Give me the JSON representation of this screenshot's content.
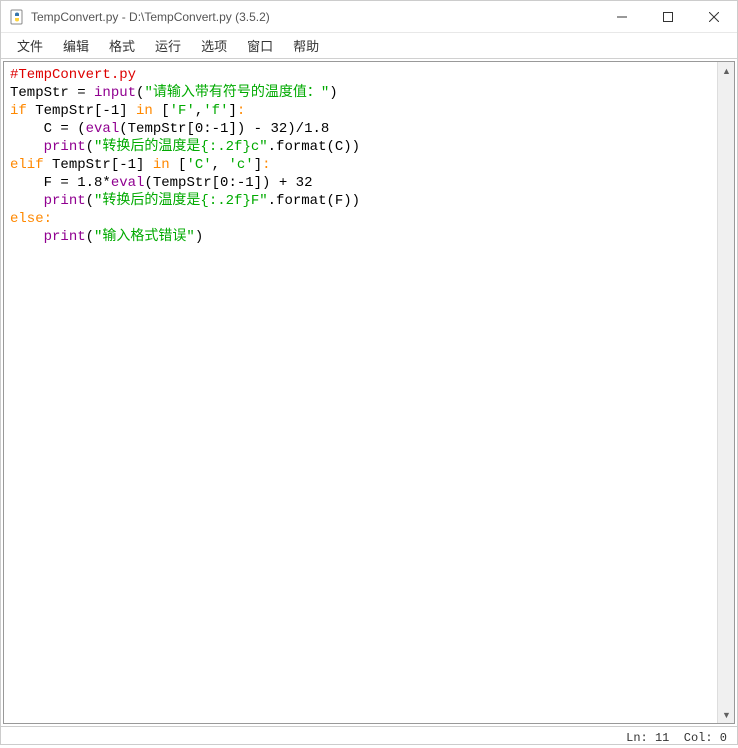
{
  "window": {
    "title": "TempConvert.py - D:\\TempConvert.py (3.5.2)"
  },
  "menu": {
    "items": [
      "文件",
      "编辑",
      "格式",
      "运行",
      "选项",
      "窗口",
      "帮助"
    ]
  },
  "code": {
    "tokens": [
      [
        {
          "t": "comment",
          "s": "#TempConvert.py"
        }
      ],
      [
        {
          "t": "text",
          "s": "TempStr = "
        },
        {
          "t": "builtin",
          "s": "input"
        },
        {
          "t": "text",
          "s": "("
        },
        {
          "t": "string",
          "s": "\"请输入带有符号的温度值：\""
        },
        {
          "t": "text",
          "s": ")"
        }
      ],
      [
        {
          "t": "keyword",
          "s": "if"
        },
        {
          "t": "text",
          "s": " TempStr[-1] "
        },
        {
          "t": "keyword",
          "s": "in"
        },
        {
          "t": "text",
          "s": " ["
        },
        {
          "t": "string",
          "s": "'F'"
        },
        {
          "t": "text",
          "s": ","
        },
        {
          "t": "string",
          "s": "'f'"
        },
        {
          "t": "text",
          "s": "]"
        },
        {
          "t": "keyword",
          "s": ":"
        }
      ],
      [
        {
          "t": "text",
          "s": "    C = ("
        },
        {
          "t": "builtin",
          "s": "eval"
        },
        {
          "t": "text",
          "s": "(TempStr[0:-1]) - 32)/1.8"
        }
      ],
      [
        {
          "t": "text",
          "s": "    "
        },
        {
          "t": "builtin",
          "s": "print"
        },
        {
          "t": "text",
          "s": "("
        },
        {
          "t": "string",
          "s": "\"转换后的温度是{:.2f}c\""
        },
        {
          "t": "text",
          "s": ".format(C))"
        }
      ],
      [
        {
          "t": "keyword",
          "s": "elif"
        },
        {
          "t": "text",
          "s": " TempStr[-1] "
        },
        {
          "t": "keyword",
          "s": "in"
        },
        {
          "t": "text",
          "s": " ["
        },
        {
          "t": "string",
          "s": "'C'"
        },
        {
          "t": "text",
          "s": ", "
        },
        {
          "t": "string",
          "s": "'c'"
        },
        {
          "t": "text",
          "s": "]"
        },
        {
          "t": "keyword",
          "s": ":"
        }
      ],
      [
        {
          "t": "text",
          "s": "    F = 1.8*"
        },
        {
          "t": "builtin",
          "s": "eval"
        },
        {
          "t": "text",
          "s": "(TempStr[0:-1]) + 32"
        }
      ],
      [
        {
          "t": "text",
          "s": "    "
        },
        {
          "t": "builtin",
          "s": "print"
        },
        {
          "t": "text",
          "s": "("
        },
        {
          "t": "string",
          "s": "\"转换后的温度是{:.2f}F\""
        },
        {
          "t": "text",
          "s": ".format(F))"
        }
      ],
      [
        {
          "t": "keyword",
          "s": "else"
        },
        {
          "t": "keyword",
          "s": ":"
        }
      ],
      [
        {
          "t": "text",
          "s": "    "
        },
        {
          "t": "builtin",
          "s": "print"
        },
        {
          "t": "text",
          "s": "("
        },
        {
          "t": "string",
          "s": "\"输入格式错误\""
        },
        {
          "t": "text",
          "s": ")"
        }
      ]
    ]
  },
  "status": {
    "line_label": "Ln:",
    "line": "11",
    "col_label": "Col:",
    "col": "0"
  }
}
